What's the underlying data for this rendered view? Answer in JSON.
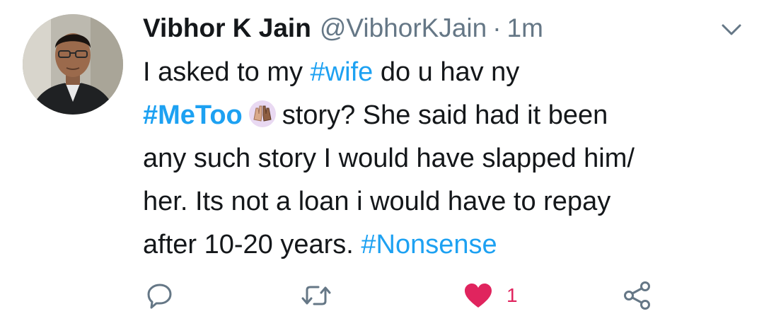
{
  "tweet": {
    "display_name": "Vibhor K Jain",
    "handle": "@VibhorKJain",
    "separator": "·",
    "time": "1m",
    "text": {
      "l1_a": "I asked to my ",
      "l1_tag": "#wife",
      "l1_b": " do u hav ny",
      "l2_tag": "#MeToo",
      "l2_b": "story? She said had it been",
      "l3": "any such story I would have slapped him/",
      "l4": "her. Its not a loan i would have to repay",
      "l5_a": "after 10-20 years. ",
      "l5_tag": "#Nonsense"
    },
    "emoji_icon": "raised-hands-emoji-icon",
    "actions": {
      "reply_icon": "reply-icon",
      "retweet_icon": "retweet-icon",
      "like_icon": "heart-icon",
      "like_count": "1",
      "share_icon": "share-icon"
    }
  },
  "colors": {
    "hashtag": "#1da1f2",
    "muted": "#657786",
    "like": "#e0245e",
    "text": "#14171a"
  }
}
